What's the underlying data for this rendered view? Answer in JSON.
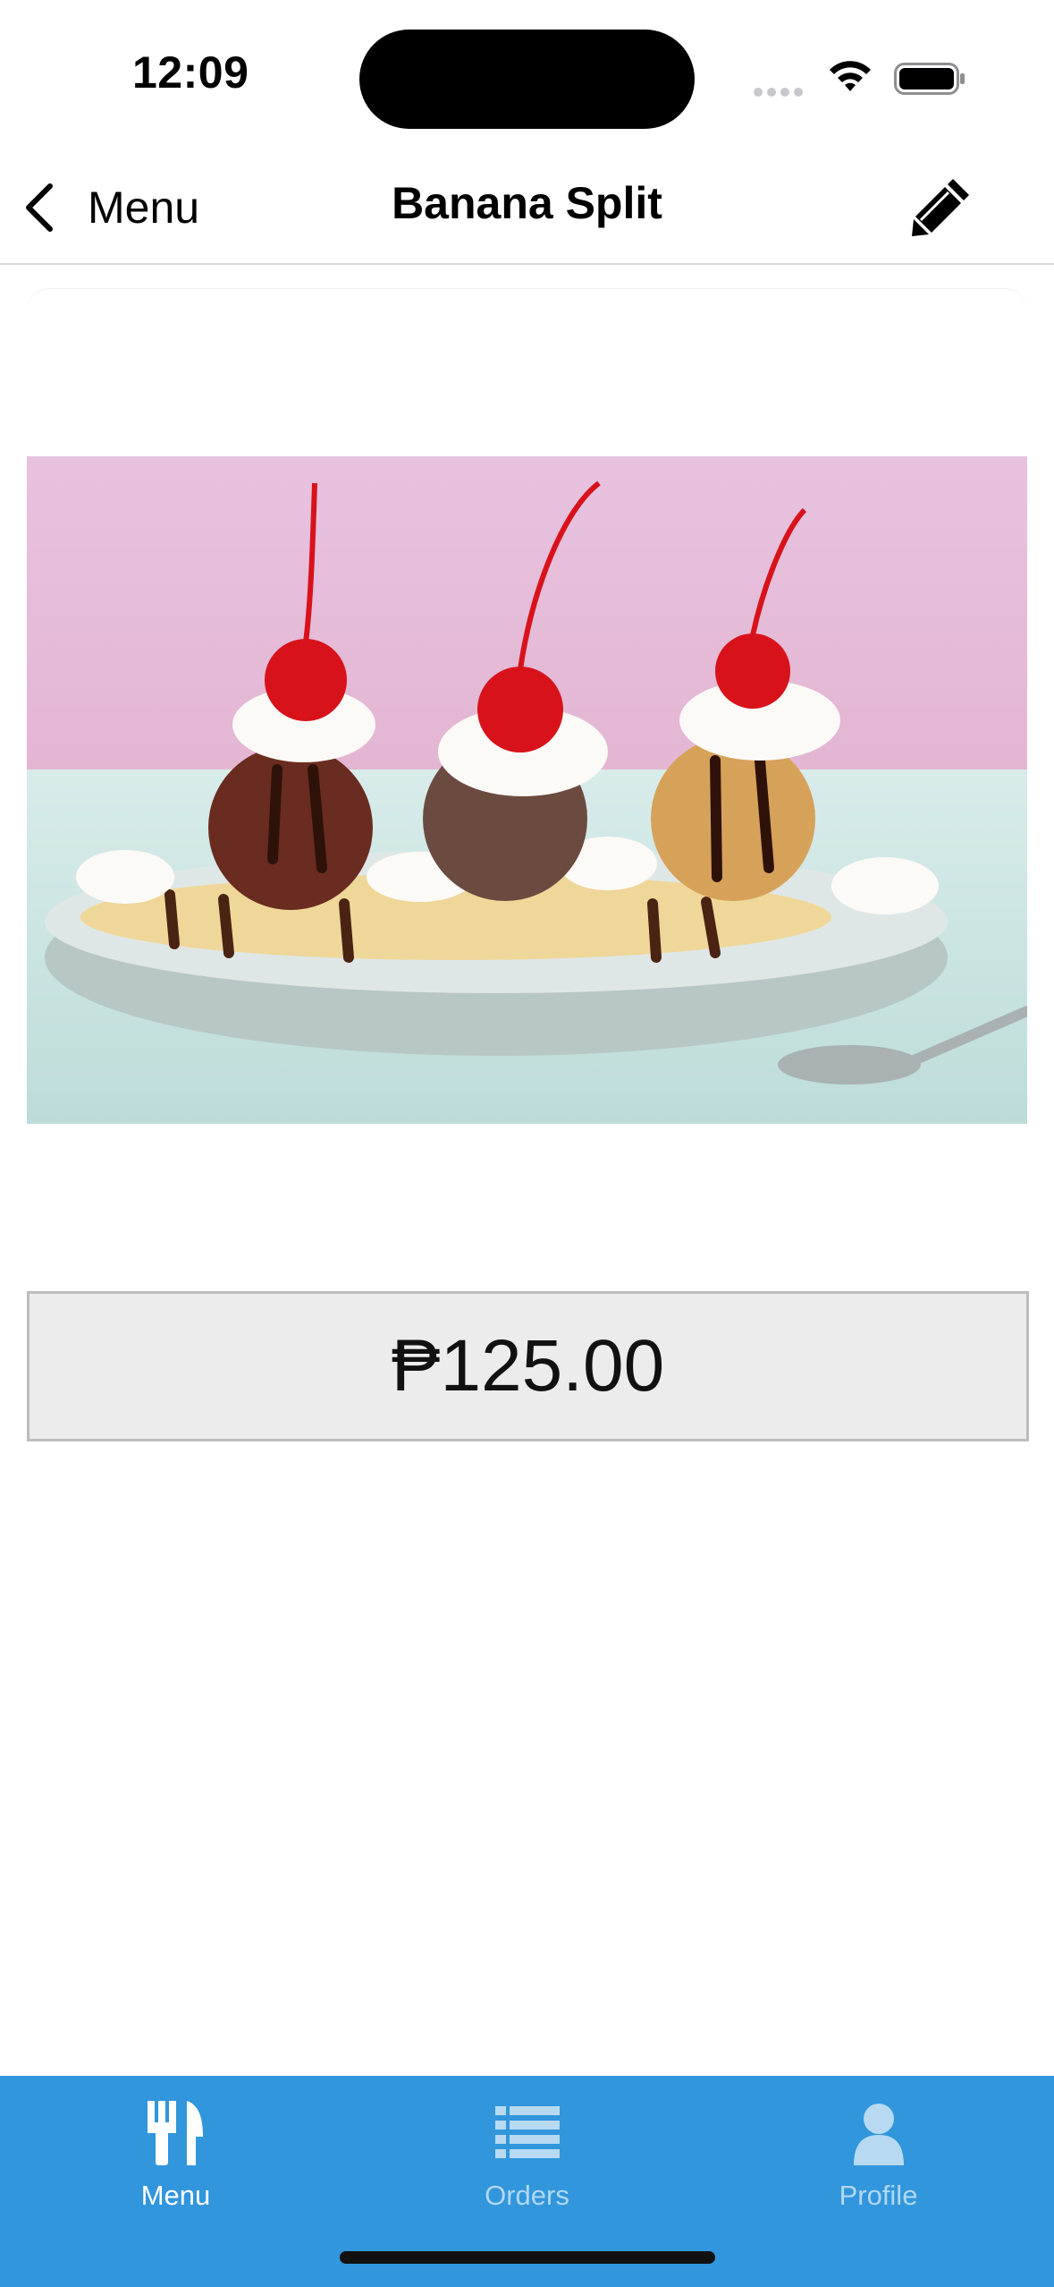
{
  "status_bar": {
    "time": "12:09"
  },
  "nav": {
    "back_label": "Menu",
    "title": "Banana Split"
  },
  "item": {
    "price": "₱125.00",
    "image_subject": "banana split sundae with three scoops, whipped cream and cherries on a plate"
  },
  "tabs": [
    {
      "label": "Menu",
      "icon": "fork-knife-icon",
      "active": true
    },
    {
      "label": "Orders",
      "icon": "list-icon",
      "active": false
    },
    {
      "label": "Profile",
      "icon": "person-icon",
      "active": false
    }
  ],
  "colors": {
    "tab_bar": "#3196dc",
    "price_box": "#ececec"
  }
}
